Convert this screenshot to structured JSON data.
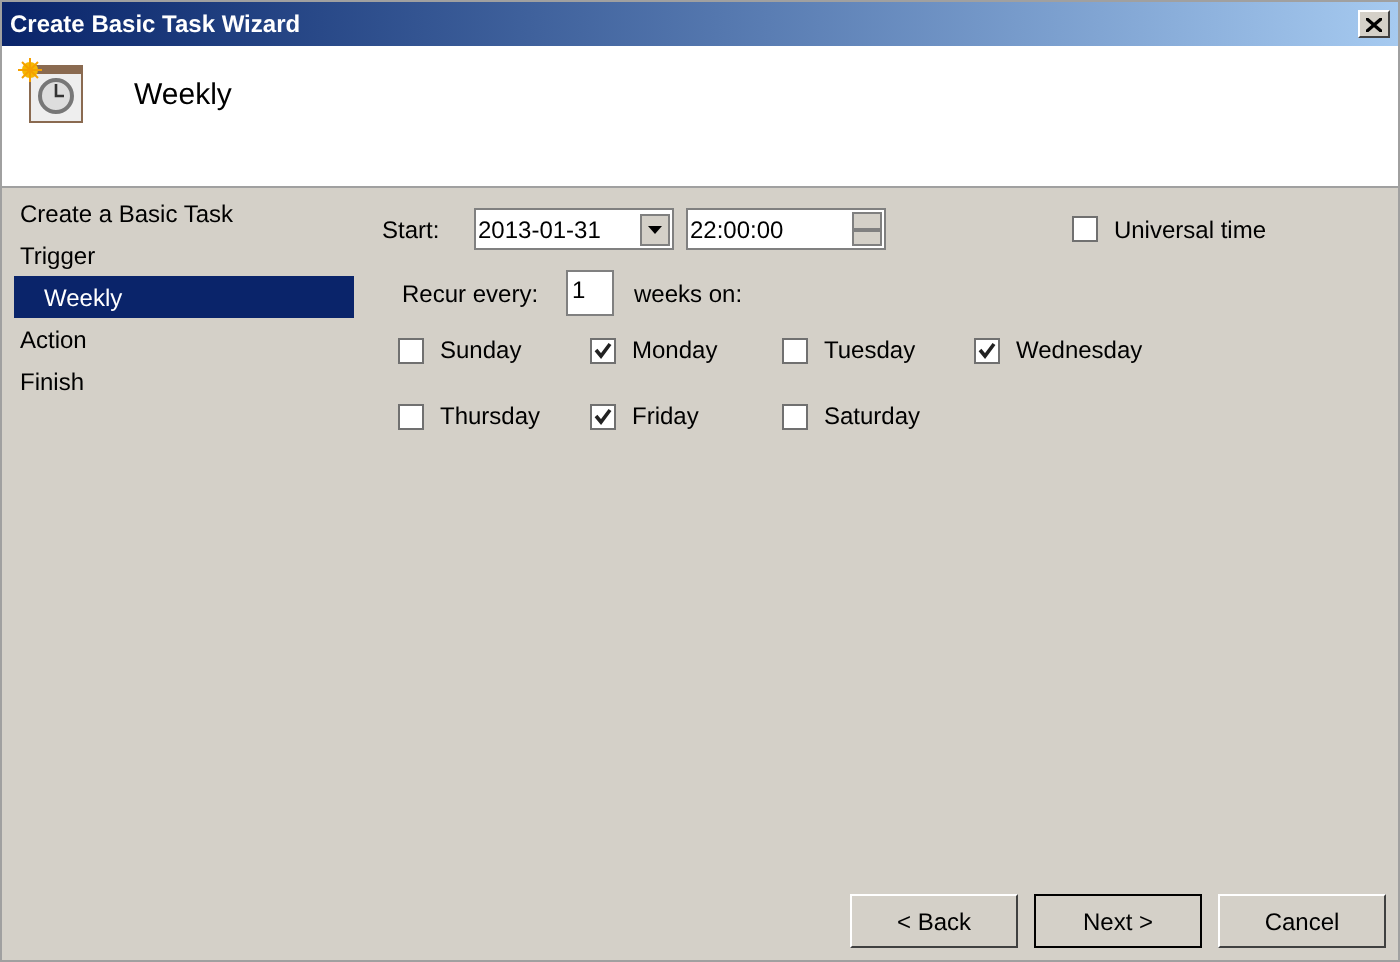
{
  "window": {
    "title": "Create Basic Task Wizard"
  },
  "header": {
    "title": "Weekly"
  },
  "steps": [
    {
      "label": "Create a Basic Task",
      "selected": false
    },
    {
      "label": "Trigger",
      "selected": false,
      "children": [
        {
          "label": "Weekly",
          "selected": true
        }
      ]
    },
    {
      "label": "Action",
      "selected": false
    },
    {
      "label": "Finish",
      "selected": false
    }
  ],
  "start": {
    "label": "Start:",
    "date": "2013-01-31",
    "time": "22:00:00"
  },
  "universal_time": {
    "label": "Universal time",
    "checked": false
  },
  "recur": {
    "label": "Recur every:",
    "value": "1",
    "suffix": "weeks on:"
  },
  "days": [
    {
      "label": "Sunday",
      "checked": false
    },
    {
      "label": "Monday",
      "checked": true
    },
    {
      "label": "Tuesday",
      "checked": false
    },
    {
      "label": "Wednesday",
      "checked": true
    },
    {
      "label": "Thursday",
      "checked": false
    },
    {
      "label": "Friday",
      "checked": true
    },
    {
      "label": "Saturday",
      "checked": false
    }
  ],
  "buttons": [
    {
      "label": "< Back",
      "default": false
    },
    {
      "label": "Next >",
      "default": true
    },
    {
      "label": "Cancel",
      "default": false
    }
  ]
}
